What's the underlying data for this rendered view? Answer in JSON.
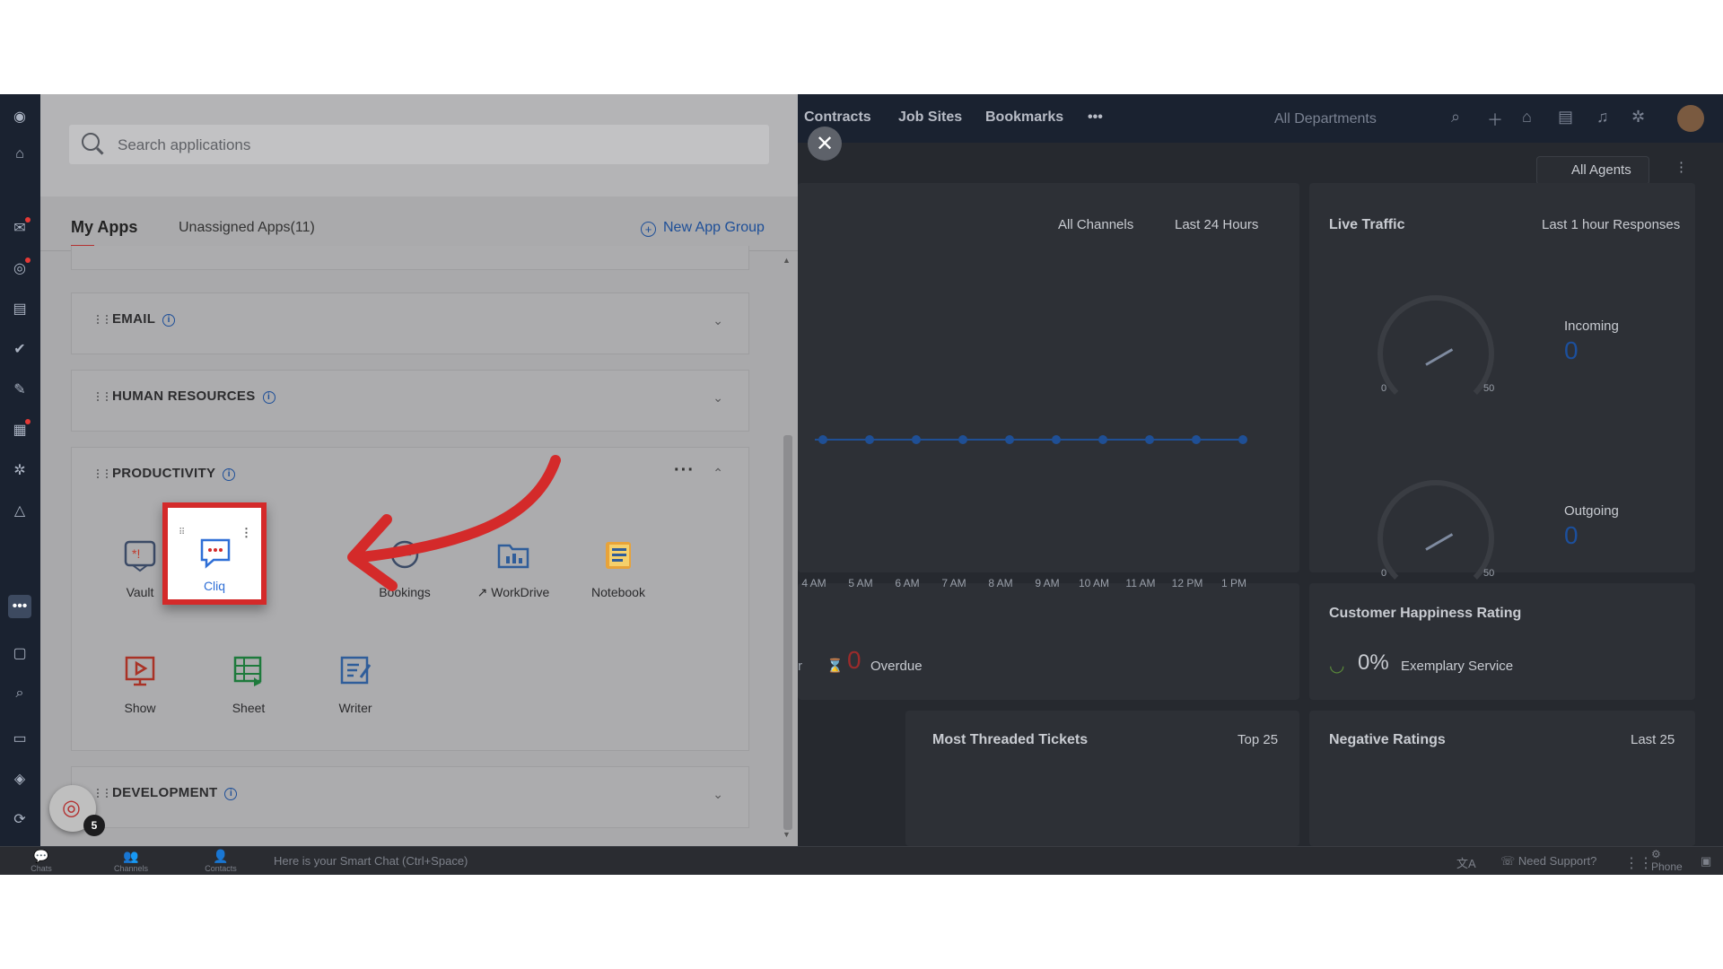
{
  "search": {
    "placeholder": "Search applications"
  },
  "tabs": {
    "my_apps": "My Apps",
    "unassigned": "Unassigned Apps(11)",
    "new_group": "New App Group"
  },
  "groups": {
    "email": "EMAIL",
    "hr": "HUMAN RESOURCES",
    "productivity": "PRODUCTIVITY",
    "development": "DEVELOPMENT"
  },
  "apps": [
    {
      "name": "Vault",
      "icon": "vault-icon"
    },
    {
      "name": "Cliq",
      "icon": "cliq-icon"
    },
    {
      "name": "Bookings",
      "icon": "bookings-icon"
    },
    {
      "name": "WorkDrive",
      "icon": "workdrive-icon"
    },
    {
      "name": "Notebook",
      "icon": "notebook-icon"
    },
    {
      "name": "Show",
      "icon": "show-icon"
    },
    {
      "name": "Sheet",
      "icon": "sheet-icon"
    },
    {
      "name": "Writer",
      "icon": "writer-icon"
    }
  ],
  "bubble_count": "5",
  "background": {
    "nav_tabs": [
      "Contracts",
      "Job Sites",
      "Bookmarks",
      "•••"
    ],
    "department": "All Departments",
    "agents": "All Agents",
    "filters": {
      "channels": "All Channels",
      "period": "Last 24 Hours"
    },
    "hours": [
      "4 AM",
      "5 AM",
      "6 AM",
      "7 AM",
      "8 AM",
      "9 AM",
      "10 AM",
      "11 AM",
      "12 PM",
      "1 PM"
    ],
    "live_traffic": {
      "title": "Live Traffic",
      "subtitle": "Last 1 hour Responses",
      "incoming_label": "Incoming",
      "incoming_value": "0",
      "outgoing_label": "Outgoing",
      "outgoing_value": "0",
      "gauge_min": "0",
      "gauge_max": "50"
    },
    "overdue": {
      "value": "0",
      "label": "Overdue",
      "prefix": "r"
    },
    "happiness": {
      "title": "Customer Happiness Rating",
      "value": "0%",
      "label": "Exemplary Service"
    },
    "threaded": {
      "title": "Most Threaded Tickets",
      "top": "Top 25"
    },
    "negative": {
      "title": "Negative Ratings",
      "last": "Last 25"
    },
    "bottom": {
      "chats": "Chats",
      "channels": "Channels",
      "contacts": "Contacts",
      "smart_chat": "Here is your Smart Chat (Ctrl+Space)",
      "support": "Need Support?",
      "phone": "Phone"
    }
  },
  "colors": {
    "accent_blue": "#1e4f98",
    "highlight_red": "#d42a2a",
    "rail": "#1a2230"
  }
}
